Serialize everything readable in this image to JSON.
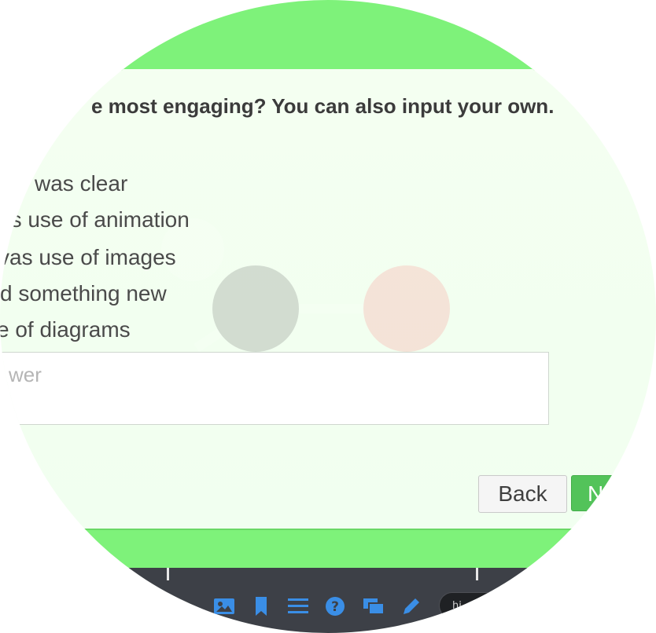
{
  "question": {
    "text": "e most engaging? You can also input your own."
  },
  "options": [
    {
      "label": "was clear"
    },
    {
      "label": "as use of animation"
    },
    {
      "label": "vas use of images"
    },
    {
      "label": "d something new"
    },
    {
      "label": "e of diagrams"
    }
  ],
  "answer_field": {
    "placeholder": "wer",
    "value": ""
  },
  "buttons": {
    "back_label": "Back",
    "next_label": "N"
  },
  "toolbar": {
    "icons": [
      "image-icon",
      "bookmark-icon",
      "menu-icon",
      "help-icon",
      "windows-icon",
      "pencil-icon"
    ],
    "pill_label": "hi"
  },
  "colors": {
    "accent_green": "#7ef27a",
    "next_button": "#53c35a",
    "toolbar_bg": "#3d4047",
    "icon_blue": "#3a8ee6"
  }
}
